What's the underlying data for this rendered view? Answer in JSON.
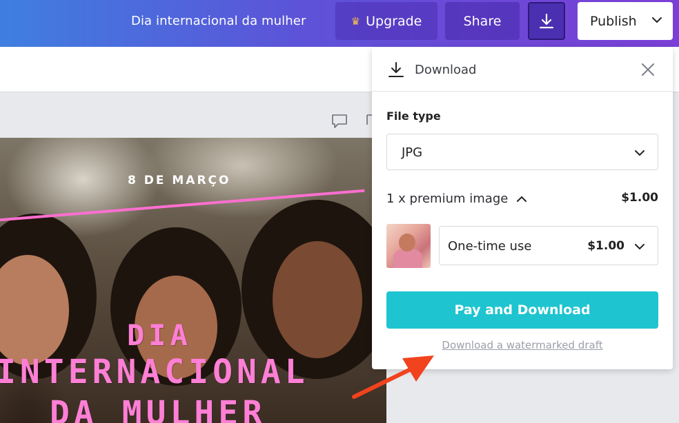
{
  "header": {
    "doc_title": "Dia internacional da mulher",
    "upgrade_label": "Upgrade",
    "share_label": "Share",
    "publish_label": "Publish"
  },
  "design": {
    "date_text": "8 DE MARÇO",
    "title_line1": "DIA",
    "title_line2": "INTERNACIONAL",
    "title_line3": "DA MULHER"
  },
  "download_panel": {
    "title": "Download",
    "file_type_label": "File type",
    "file_type_value": "JPG",
    "premium_label": "1 x premium image",
    "premium_total": "$1.00",
    "license_value": "One-time use",
    "license_price": "$1.00",
    "pay_button": "Pay and Download",
    "watermark_link": "Download a watermarked draft"
  },
  "colors": {
    "header_gradient_start": "#3f7fe0",
    "header_gradient_end": "#7b3fd6",
    "pay_button": "#1ec4cf",
    "design_accent_pink": "#ff7fd6",
    "annotation_arrow": "#f0431e"
  },
  "icons": {
    "upgrade": "crown-icon",
    "download": "download-icon",
    "publish_chevron": "chevron-down-icon",
    "close": "close-icon",
    "premium_toggle": "chevron-up-icon"
  }
}
